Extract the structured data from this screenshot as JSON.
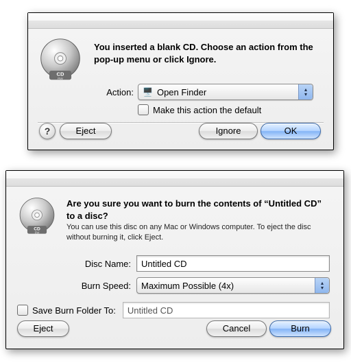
{
  "dialog1": {
    "message": "You inserted a blank CD. Choose an action from the pop-up menu or click Ignore.",
    "action_label": "Action:",
    "action_value": "Open Finder",
    "checkbox_label": "Make this action the default",
    "help_glyph": "?",
    "eject_label": "Eject",
    "ignore_label": "Ignore",
    "ok_label": "OK"
  },
  "dialog2": {
    "heading": "Are you sure you want to burn the contents of “Untitled CD” to a disc?",
    "subtext": "You can use this disc on any Mac or Windows computer. To eject the disc without burning it, click Eject.",
    "disc_name_label": "Disc Name:",
    "disc_name_value": "Untitled CD",
    "burn_speed_label": "Burn Speed:",
    "burn_speed_value": "Maximum Possible (4x)",
    "save_folder_label": "Save Burn Folder To:",
    "save_folder_value": "Untitled CD",
    "eject_label": "Eject",
    "cancel_label": "Cancel",
    "burn_label": "Burn"
  },
  "icons": {
    "cd_label": "CD",
    "cd_sub": "RW"
  }
}
